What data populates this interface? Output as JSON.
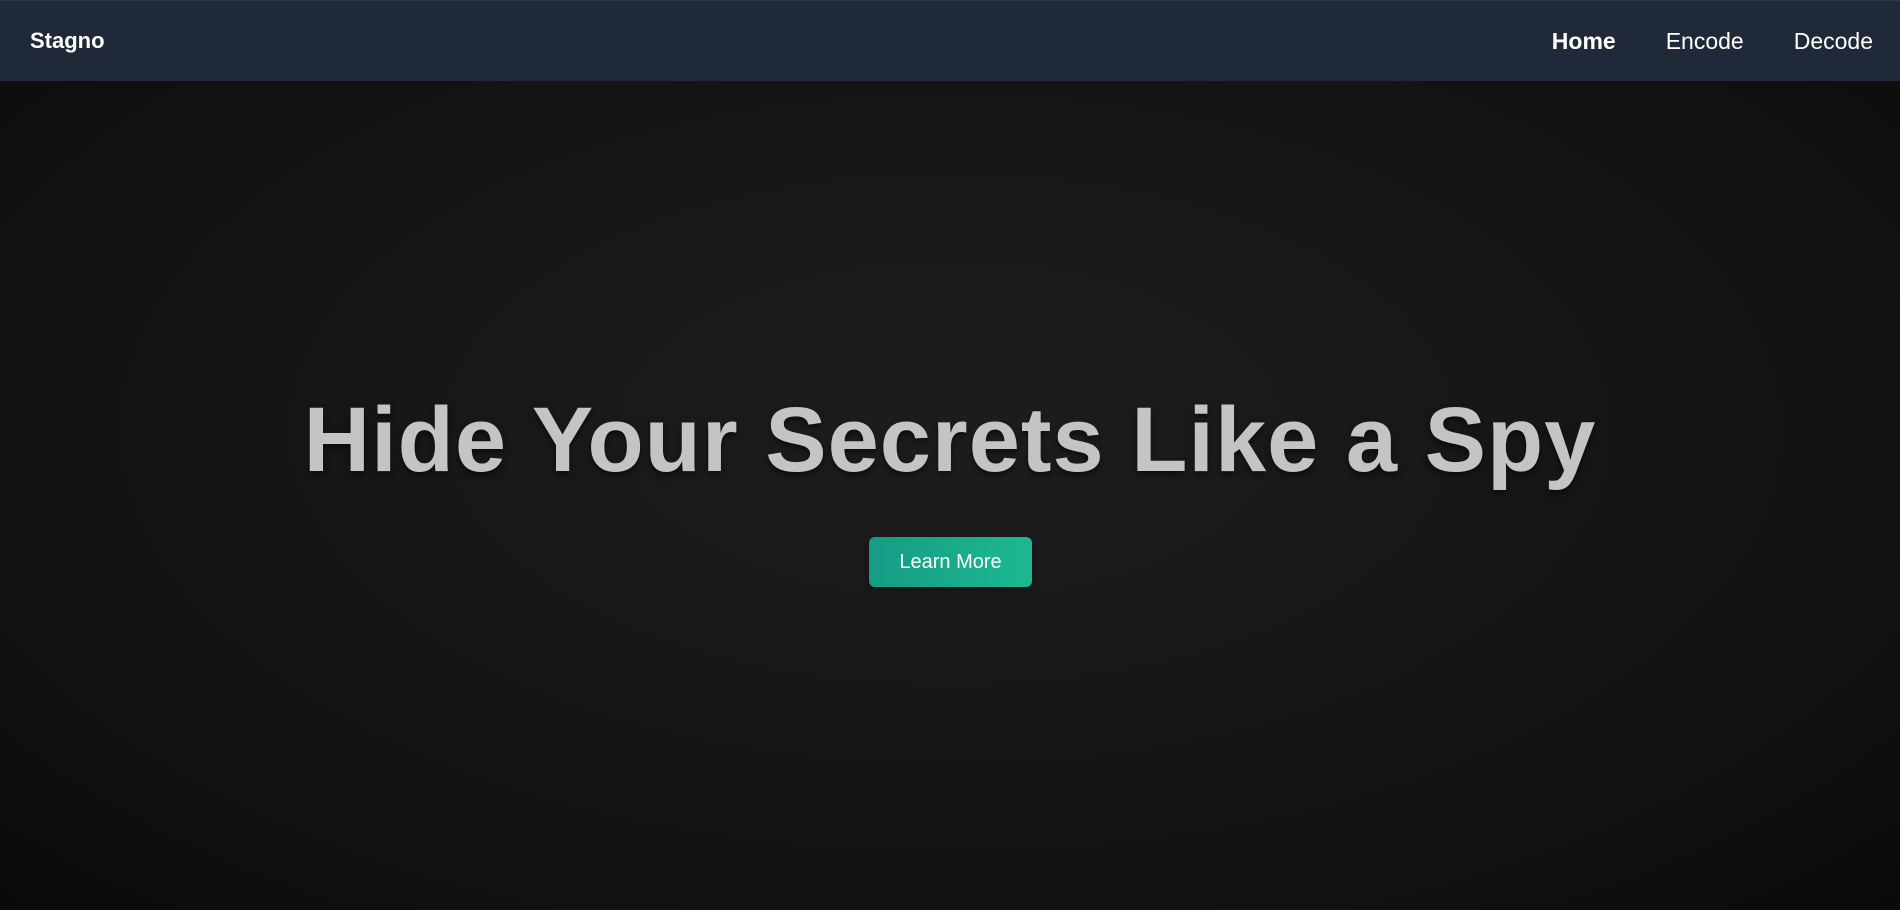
{
  "nav": {
    "brand": "Stagno",
    "links": [
      {
        "label": "Home",
        "active": true
      },
      {
        "label": "Encode",
        "active": false
      },
      {
        "label": "Decode",
        "active": false
      }
    ]
  },
  "hero": {
    "title": "Hide Your Secrets Like a Spy",
    "cta_label": "Learn More"
  },
  "colors": {
    "navbar_bg": "#1f2937",
    "page_bg": "#121212",
    "title_text": "#c4c4c4",
    "accent": "#1abc9c"
  }
}
